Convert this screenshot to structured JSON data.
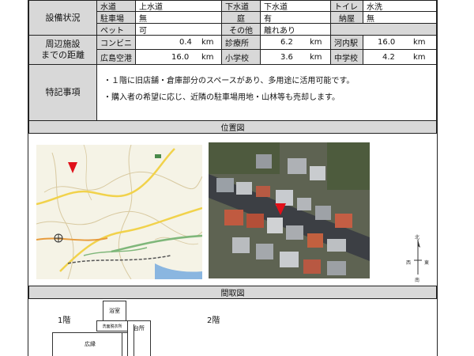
{
  "facilities": {
    "section_label": "設備状況",
    "water": {
      "label": "水道",
      "value": "上水道"
    },
    "sewer": {
      "label": "下水道",
      "value": "下水道"
    },
    "toilet": {
      "label": "トイレ",
      "value": "水洗"
    },
    "parking": {
      "label": "駐車場",
      "value": "無"
    },
    "garden": {
      "label": "庭",
      "value": "有"
    },
    "shed": {
      "label": "納屋",
      "value": "無"
    },
    "pets": {
      "label": "ペット",
      "value": "可"
    },
    "other": {
      "label": "その他",
      "value": "離れあり"
    }
  },
  "distances": {
    "section_label": "周辺施設\nまでの距離",
    "unit": "km",
    "items": [
      {
        "label": "コンビニ",
        "value": "0.4"
      },
      {
        "label": "診療所",
        "value": "6.2"
      },
      {
        "label": "河内駅",
        "value": "16.0"
      },
      {
        "label": "広島空港",
        "value": "16.0"
      },
      {
        "label": "小学校",
        "value": "3.6"
      },
      {
        "label": "中学校",
        "value": "4.2"
      }
    ]
  },
  "remarks": {
    "section_label": "特記事項",
    "lines": [
      "・１階に旧店舗・倉庫部分のスペースがあり、多用途に活用可能です。",
      "・購入者の希望に応じ、近隣の駐車場用地・山林等も売却します。"
    ]
  },
  "location": {
    "header": "位置図",
    "compass": {
      "north": "北",
      "west": "西",
      "east": "東",
      "south": "南"
    }
  },
  "floorplan": {
    "header": "間取図",
    "floor1": "1階",
    "floor2": "2階",
    "rooms": {
      "bath": "浴室",
      "washroom": "洗面脱衣所",
      "kitchen": "台所",
      "hall": "広縁"
    }
  },
  "colors": {
    "label_bg": "#d8d8d8",
    "marker": "#e0101a",
    "map_bg": "#f5f3e6"
  }
}
